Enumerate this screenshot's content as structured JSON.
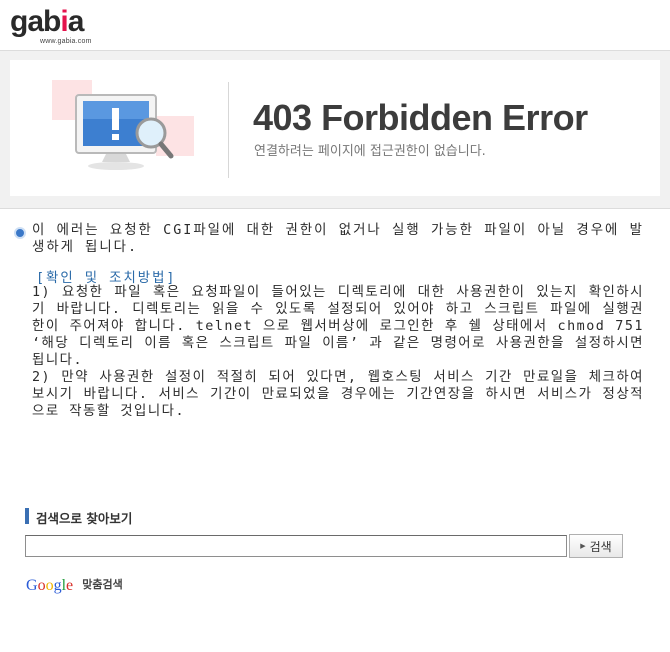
{
  "header": {
    "logo_text": "gabia",
    "logo_subtext": "www.gabia.com"
  },
  "banner": {
    "title": "403 Forbidden Error",
    "subtitle": "연결하려는 페이지에 접근권한이 없습니다."
  },
  "message": {
    "main": "이 에러는 요청한 CGI파일에 대한 권한이 없거나 실행 가능한 파일이 아닐 경우에 발생하게 됩니다.",
    "method_title": "[확인 및 조치방법]",
    "steps": [
      "1) 요청한 파일 혹은 요청파일이 들어있는 디렉토리에 대한 사용권한이 있는지 확인하시기 바랍니다. 디렉토리는 읽을 수 있도록 설정되어 있어야 하고 스크립트 파일에 실행권한이 주어져야 합니다. telnet 으로 웹서버상에 로그인한 후 쉘 상태에서 chmod 751 ‘해당 디렉토리 이름 혹은 스크립트 파일 이름’ 과 같은 명령어로 사용권한을 설정하시면 됩니다.",
      "2) 만약 사용권한 설정이 적절히 되어 있다면, 웹호스팅 서비스 기간 만료일을 체크하여 보시기 바랍니다. 서비스 기간이 만료되었을 경우에는 기간연장을 하시면 서비스가 정상적으로 작동할 것입니다."
    ]
  },
  "search": {
    "heading": "검색으로 찾아보기",
    "input_value": "",
    "button_label": "검색"
  },
  "footer": {
    "google_brand": "Google",
    "custom_search": "맞춤검색"
  },
  "colors": {
    "logo_accent": "#e4134c",
    "method_title": "#2a6aa8",
    "bullet": "#3a78c8"
  },
  "icons": {
    "banner_illustration": "monitor-warning-magnifier-icon",
    "bullet": "bullet-circle-icon",
    "search_marker": "section-bar-icon",
    "button_arrow": "triangle-right-icon"
  }
}
